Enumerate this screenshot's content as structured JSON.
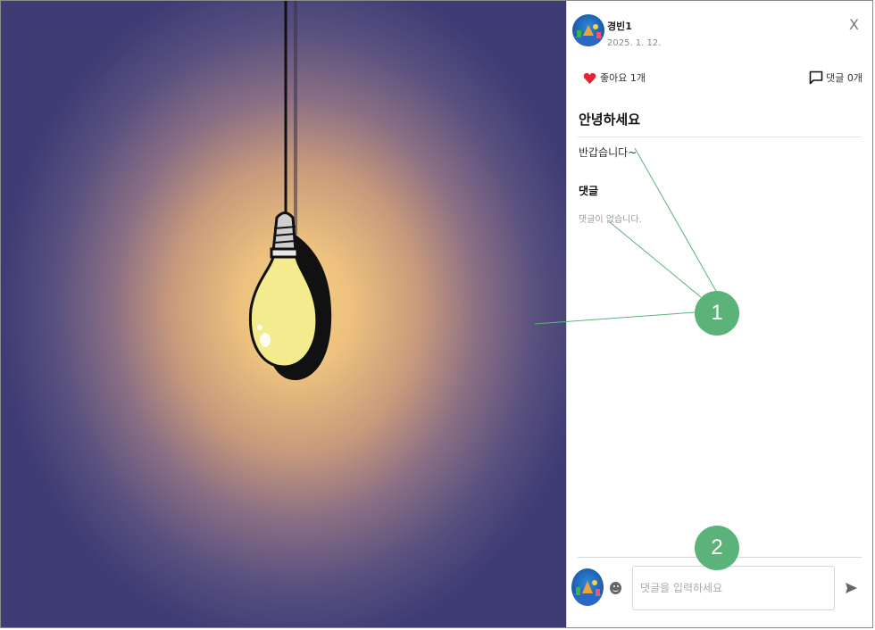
{
  "post": {
    "author_name": "경빈1",
    "date": "2025. 1. 12.",
    "close_label": "X",
    "likes_label": "좋아요 1개",
    "comments_count_label": "댓글 0개",
    "title": "안녕하세요",
    "body": "반갑습니다~"
  },
  "comments": {
    "heading": "댓글",
    "empty_message": "댓글이 없습니다.",
    "input_placeholder": "댓글을 입력하세요"
  },
  "annotations": {
    "marker_1": "1",
    "marker_2": "2",
    "color": "#5bb37a"
  },
  "icons": {
    "like": "heart-icon",
    "comment": "speech-bubble-icon",
    "emoji": "smiley-icon",
    "send": "send-icon",
    "close": "close-icon"
  },
  "colors": {
    "heart": "#e0282e",
    "image_background": "#3f3c75",
    "bulb_glass": "#f3eb8e"
  }
}
